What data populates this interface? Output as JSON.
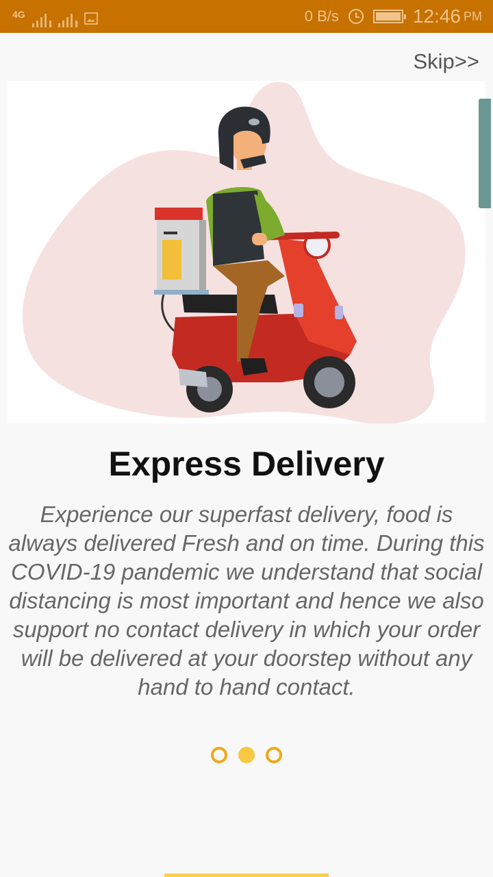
{
  "status_bar": {
    "network": "4G",
    "data_speed": "0 B/s",
    "time": "12:46",
    "ampm": "PM"
  },
  "onboarding": {
    "skip_label": "Skip>>",
    "illustration": "delivery-rider-on-scooter",
    "title": "Express Delivery",
    "description": "Experience our superfast delivery, food is always delivered Fresh and on time. During this COVID-19 pandemic we understand that social distancing is most important and hence we also support no contact delivery in which your order will be delivered at your doorstep without any hand to hand contact.",
    "pages": 3,
    "active_page": 2
  },
  "colors": {
    "status_bar": "#c67100",
    "accent": "#f7c943",
    "dot_outline": "#f0a81a",
    "scroll_thumb": "#6b9793"
  }
}
